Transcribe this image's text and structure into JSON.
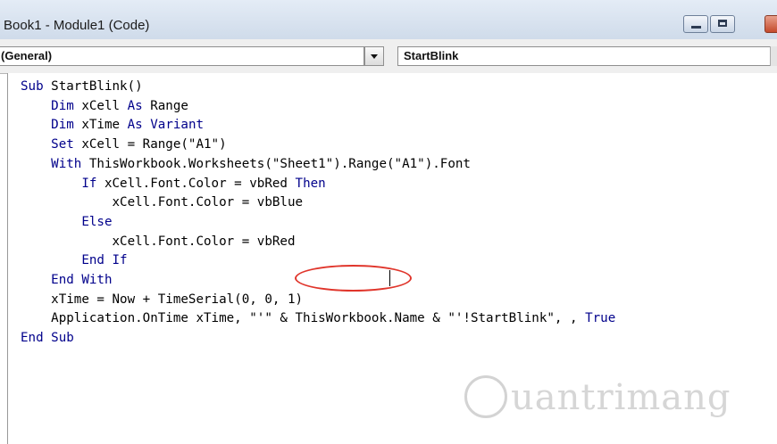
{
  "window": {
    "title": "Book1 - Module1 (Code)"
  },
  "toolbar": {
    "object_combo": "(General)",
    "procedure_combo": "StartBlink"
  },
  "code_lines": [
    [
      {
        "t": "Sub",
        "k": true
      },
      {
        "t": " StartBlink()"
      }
    ],
    [
      {
        "t": "    "
      },
      {
        "t": "Dim",
        "k": true
      },
      {
        "t": " xCell "
      },
      {
        "t": "As",
        "k": true
      },
      {
        "t": " Range"
      }
    ],
    [
      {
        "t": "    "
      },
      {
        "t": "Dim",
        "k": true
      },
      {
        "t": " xTime "
      },
      {
        "t": "As",
        "k": true
      },
      {
        "t": " "
      },
      {
        "t": "Variant",
        "k": true
      }
    ],
    [
      {
        "t": "    "
      },
      {
        "t": "Set",
        "k": true
      },
      {
        "t": " xCell = Range(\"A1\")"
      }
    ],
    [
      {
        "t": "    "
      },
      {
        "t": "With",
        "k": true
      },
      {
        "t": " ThisWorkbook.Worksheets(\"Sheet1\").Range(\"A1\").Font"
      }
    ],
    [
      {
        "t": "        "
      },
      {
        "t": "If",
        "k": true
      },
      {
        "t": " xCell.Font.Color = vbRed "
      },
      {
        "t": "Then",
        "k": true
      }
    ],
    [
      {
        "t": "            xCell.Font.Color = vbBlue"
      }
    ],
    [
      {
        "t": "        "
      },
      {
        "t": "Else",
        "k": true
      }
    ],
    [
      {
        "t": "            xCell.Font.Color = vbRed"
      }
    ],
    [
      {
        "t": "        "
      },
      {
        "t": "End If",
        "k": true
      }
    ],
    [
      {
        "t": "    "
      },
      {
        "t": "End With",
        "k": true
      }
    ],
    [
      {
        "t": "    xTime = Now + TimeSerial(0, 0, 1)"
      }
    ],
    [
      {
        "t": "    Application.OnTime xTime, \"'\" & ThisWorkbook.Name & \"'!StartBlink\", , "
      },
      {
        "t": "True",
        "k": true
      }
    ],
    [
      {
        "t": "End Sub",
        "k": true
      }
    ]
  ],
  "watermark": {
    "text": "uantrimang"
  },
  "colors": {
    "keyword": "#00008b",
    "highlight": "#e0352b"
  },
  "icons": [
    "minimize-icon",
    "maximize-icon",
    "close-icon",
    "dropdown-arrow-icon",
    "quantrimang-logo-icon"
  ]
}
